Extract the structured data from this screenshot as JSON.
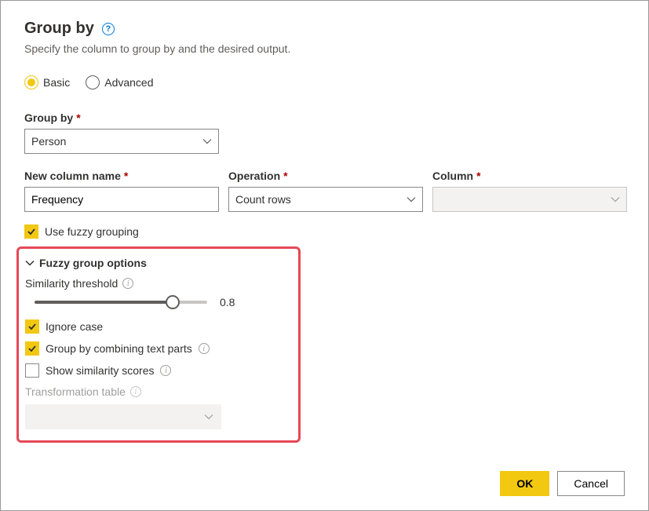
{
  "dialog": {
    "title": "Group by",
    "subtitle": "Specify the column to group by and the desired output."
  },
  "mode": {
    "basic": "Basic",
    "advanced": "Advanced",
    "selected": "basic"
  },
  "groupBy": {
    "label": "Group by",
    "value": "Person"
  },
  "newColumn": {
    "label": "New column name",
    "value": "Frequency"
  },
  "operation": {
    "label": "Operation",
    "value": "Count rows"
  },
  "column": {
    "label": "Column",
    "value": ""
  },
  "fuzzy": {
    "useLabel": "Use fuzzy grouping",
    "useChecked": true,
    "sectionTitle": "Fuzzy group options",
    "similarity": {
      "label": "Similarity threshold",
      "value": 0.8,
      "display": "0.8"
    },
    "ignoreCase": {
      "label": "Ignore case",
      "checked": true
    },
    "combineText": {
      "label": "Group by combining text parts",
      "checked": true
    },
    "showScores": {
      "label": "Show similarity scores",
      "checked": false
    },
    "transformTable": {
      "label": "Transformation table",
      "value": ""
    }
  },
  "buttons": {
    "ok": "OK",
    "cancel": "Cancel"
  }
}
